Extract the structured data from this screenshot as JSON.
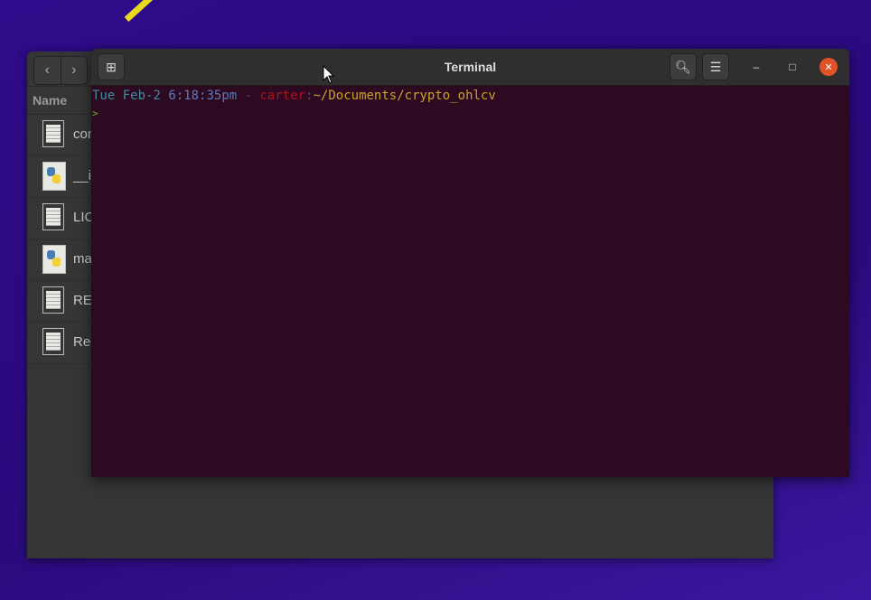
{
  "file_manager": {
    "column_header": "Name",
    "files": [
      {
        "name": "con",
        "icon": "text-file-icon"
      },
      {
        "name": "__i",
        "icon": "python-file-icon"
      },
      {
        "name": "LIC",
        "icon": "text-file-icon"
      },
      {
        "name": "ma",
        "icon": "python-file-icon"
      },
      {
        "name": "RE",
        "icon": "text-file-icon"
      },
      {
        "name": "Rec",
        "icon": "text-file-icon"
      }
    ]
  },
  "terminal": {
    "title": "Terminal",
    "prompt": {
      "day": "Tue",
      "date": "Feb-2",
      "time": "6:18:35pm",
      "sep": " - ",
      "user": "carter",
      "colon": ":",
      "path": "~/Documents/crypto_ohlcv",
      "symbol": ">"
    }
  },
  "colors": {
    "day": "#3f8f9f",
    "time": "#5b7ab5",
    "user": "#b0101c",
    "path": "#c9a227",
    "symbol": "#6fae23",
    "close": "#e05326"
  }
}
